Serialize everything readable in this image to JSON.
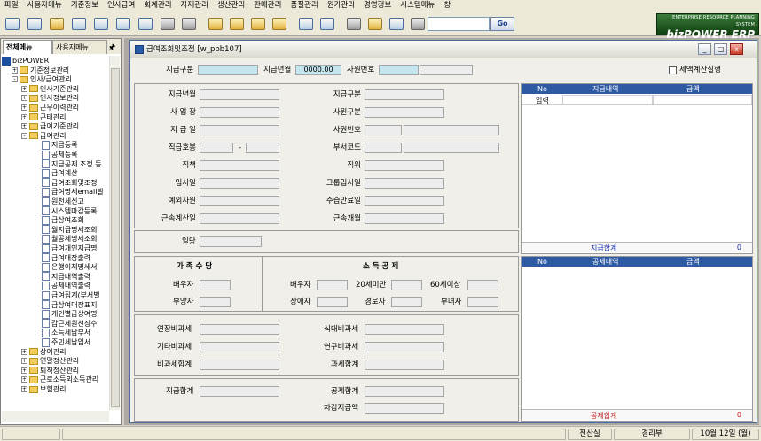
{
  "menu": [
    "파일",
    "사용자메뉴",
    "기준정보",
    "인사급여",
    "회계관리",
    "자재관리",
    "생산관리",
    "판매관리",
    "품질관리",
    "원가관리",
    "경영정보",
    "시스템메뉴",
    "창"
  ],
  "toolbar": {
    "search_value": "",
    "go_label": "Go",
    "icons": [
      "open-icon",
      "view-icon",
      "new-icon",
      "save-icon",
      "print-icon",
      "preview-icon",
      "excel-icon",
      "delete-icon",
      "clear-icon",
      "first-icon",
      "prev-icon",
      "next-icon",
      "last-icon",
      "settings-icon",
      "lock-icon",
      "tools-icon",
      "cart-icon",
      "calc-icon",
      "exit-icon"
    ]
  },
  "logo": {
    "line1": "ENTERPRISE RESOURCE PLANNING SYSTEM",
    "line2": "bizPOWER ERP"
  },
  "left": {
    "tab_all": "전체메뉴",
    "tab_user": "사용자메뉴",
    "tree": [
      {
        "label": "bizPOWER",
        "level": 0,
        "type": "root"
      },
      {
        "label": "기준정보관리",
        "level": 1,
        "type": "folder",
        "exp": "+"
      },
      {
        "label": "인사/급여관리",
        "level": 1,
        "type": "folder",
        "exp": "-"
      },
      {
        "label": "인사기준관리",
        "level": 2,
        "type": "folder",
        "exp": "+"
      },
      {
        "label": "인사정보관리",
        "level": 2,
        "type": "folder",
        "exp": "+"
      },
      {
        "label": "근무이력관리",
        "level": 2,
        "type": "folder",
        "exp": "+"
      },
      {
        "label": "근태관리",
        "level": 2,
        "type": "folder",
        "exp": "+"
      },
      {
        "label": "급여기준관리",
        "level": 2,
        "type": "folder",
        "exp": "+"
      },
      {
        "label": "급여관리",
        "level": 2,
        "type": "folder",
        "exp": "-"
      },
      {
        "label": "지급등록",
        "level": 3,
        "type": "page"
      },
      {
        "label": "공제등록",
        "level": 3,
        "type": "page"
      },
      {
        "label": "지급공제 조정 등",
        "level": 3,
        "type": "page"
      },
      {
        "label": "급여계산",
        "level": 3,
        "type": "page"
      },
      {
        "label": "급여조회및조정",
        "level": 3,
        "type": "page"
      },
      {
        "label": "급여명세email발",
        "level": 3,
        "type": "page"
      },
      {
        "label": "원천세신고",
        "level": 3,
        "type": "page"
      },
      {
        "label": "시스템마감등록",
        "level": 3,
        "type": "page"
      },
      {
        "label": "급상여조회",
        "level": 3,
        "type": "page"
      },
      {
        "label": "월지급명세조회",
        "level": 3,
        "type": "page"
      },
      {
        "label": "월공제명세조회",
        "level": 3,
        "type": "page"
      },
      {
        "label": "급여개인지급명",
        "level": 3,
        "type": "page"
      },
      {
        "label": "급여대장출력",
        "level": 3,
        "type": "page"
      },
      {
        "label": "은행이체명세서",
        "level": 3,
        "type": "page"
      },
      {
        "label": "지급내역출력",
        "level": 3,
        "type": "page"
      },
      {
        "label": "공제내역출력",
        "level": 3,
        "type": "page"
      },
      {
        "label": "급여집계(부서별",
        "level": 3,
        "type": "page"
      },
      {
        "label": "급상여대장표지",
        "level": 3,
        "type": "page"
      },
      {
        "label": "개인별급상여명",
        "level": 3,
        "type": "page"
      },
      {
        "label": "갑근세원천징수",
        "level": 3,
        "type": "page"
      },
      {
        "label": "소득세납부서",
        "level": 3,
        "type": "page"
      },
      {
        "label": "주민세납입서",
        "level": 3,
        "type": "page"
      },
      {
        "label": "상여관리",
        "level": 2,
        "type": "folder",
        "exp": "+"
      },
      {
        "label": "연말정산관리",
        "level": 2,
        "type": "folder",
        "exp": "+"
      },
      {
        "label": "퇴직정산관리",
        "level": 2,
        "type": "folder",
        "exp": "+"
      },
      {
        "label": "근로소득외소득관리",
        "level": 2,
        "type": "folder",
        "exp": "+"
      },
      {
        "label": "보험관리",
        "level": 2,
        "type": "folder",
        "exp": "+"
      }
    ]
  },
  "window": {
    "title": "급여조회및조정 [w_pbb107]",
    "min": "_",
    "max": "□",
    "close": "x"
  },
  "header": {
    "pay_type_label": "지급구분",
    "pay_month_label": "지급년월",
    "pay_month_value": "0000.00",
    "emp_no_label": "사원번호",
    "tax_check_label": "세액계산실행"
  },
  "info": {
    "left_labels": [
      "지급년월",
      "사 업 장",
      "지 급 일",
      "직급호봉",
      "직책",
      "입사일",
      "예외사원",
      "근속계산일"
    ],
    "dash": "-",
    "right_labels": [
      "지급구분",
      "사원구분",
      "사원번호",
      "부서코드",
      "직위",
      "그룹입사일",
      "수습만료일",
      "근속개월"
    ],
    "daily_label": "일당"
  },
  "family": {
    "title_left": "가 족 수 당",
    "title_right": "소 득 공 제",
    "spouse": "배우자",
    "dependent": "부양자",
    "spouse2": "배우자",
    "under20": "20세미만",
    "over60": "60세이상",
    "disabled": "장애자",
    "senior": "경로자",
    "female": "부녀자"
  },
  "tax": {
    "overtime_exempt": "연장비과세",
    "meal_exempt": "식대비과세",
    "other_exempt": "기타비과세",
    "research_exempt": "연구비과세",
    "exempt_total": "비과세합계",
    "taxable_total": "과세합계"
  },
  "totals": {
    "pay_total": "지급합계",
    "deduct_total": "공제합계",
    "net_pay": "차감지급액"
  },
  "grid1": {
    "headers": [
      "No",
      "지급내역",
      "금액"
    ],
    "rows": [
      {
        "no": "입력",
        "name": "",
        "amount": ""
      }
    ],
    "total_label": "지급합계",
    "total_value": "0"
  },
  "grid2": {
    "headers": [
      "No",
      "공제내역",
      "금액"
    ],
    "total_label": "공제합계",
    "total_value": "0"
  },
  "status": {
    "dept": "전산실",
    "team": "경리부",
    "date": "10월 12일 (월)"
  }
}
